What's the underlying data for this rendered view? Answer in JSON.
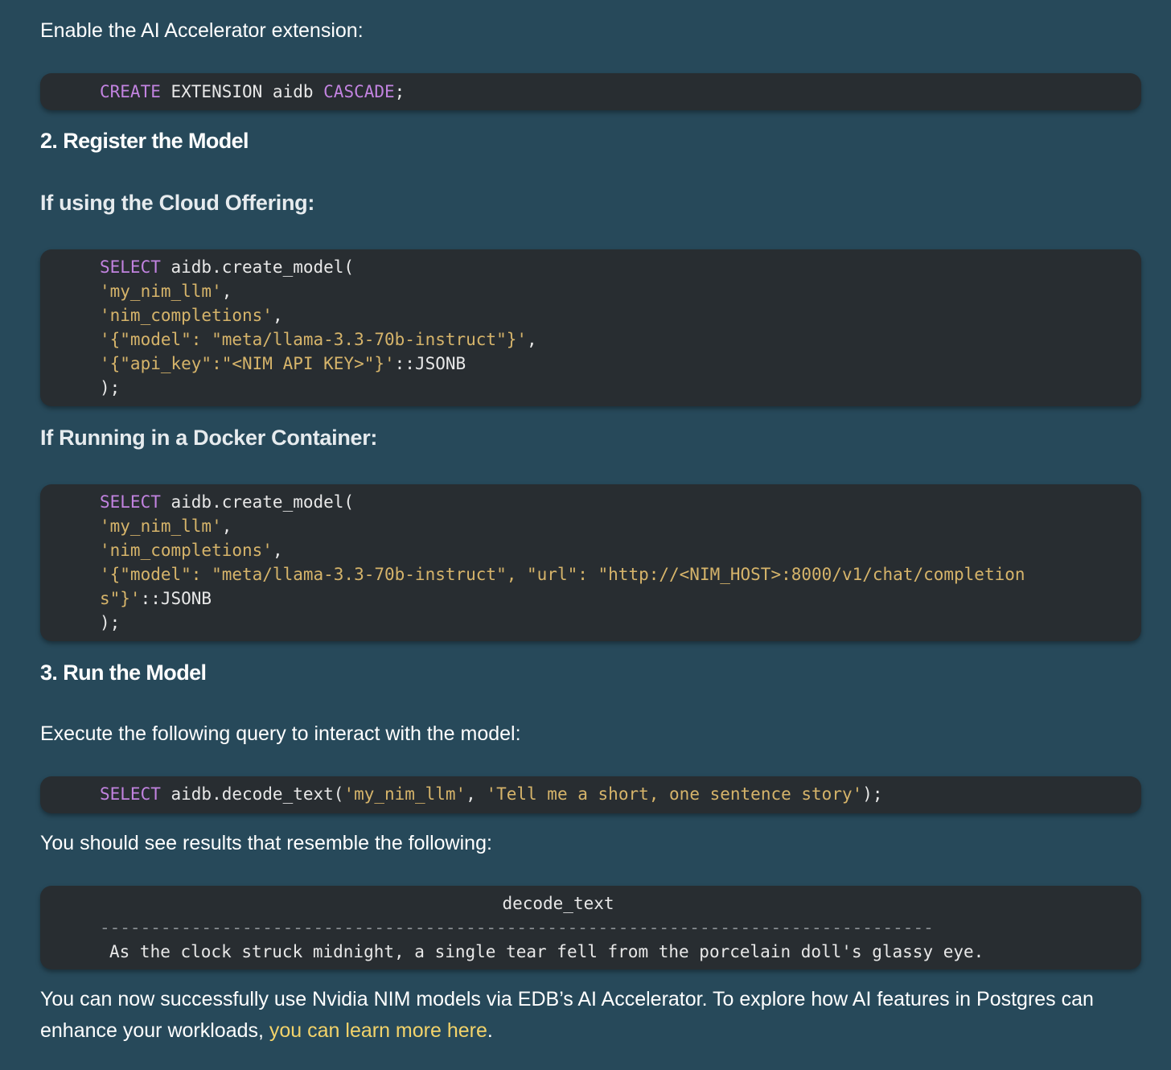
{
  "intro_text": "Enable the AI Accelerator extension:",
  "code1": {
    "lines": [
      [
        {
          "t": "CREATE",
          "c": "kw"
        },
        {
          "t": " EXTENSION aidb ",
          "c": ""
        },
        {
          "t": "CASCADE",
          "c": "kw"
        },
        {
          "t": ";",
          "c": ""
        }
      ]
    ]
  },
  "heading_register": "2. Register the Model",
  "heading_cloud": "If using the Cloud Offering:",
  "code2": {
    "lines": [
      [
        {
          "t": "SELECT",
          "c": "kw"
        },
        {
          "t": " aidb.create_model(",
          "c": ""
        }
      ],
      [
        {
          "t": "'my_nim_llm'",
          "c": "str"
        },
        {
          "t": ",",
          "c": ""
        }
      ],
      [
        {
          "t": "'nim_completions'",
          "c": "str"
        },
        {
          "t": ",",
          "c": ""
        }
      ],
      [
        {
          "t": "'{\"model\": \"meta/llama-3.3-70b-instruct\"}'",
          "c": "str"
        },
        {
          "t": ",",
          "c": ""
        }
      ],
      [
        {
          "t": "'{\"api_key\":\"<NIM API KEY>\"}'",
          "c": "str"
        },
        {
          "t": "::JSONB",
          "c": ""
        }
      ],
      [
        {
          "t": ");",
          "c": ""
        }
      ]
    ]
  },
  "heading_docker": "If Running in a Docker Container:",
  "code3": {
    "lines": [
      [
        {
          "t": "SELECT",
          "c": "kw"
        },
        {
          "t": " aidb.create_model(",
          "c": ""
        }
      ],
      [
        {
          "t": "'my_nim_llm'",
          "c": "str"
        },
        {
          "t": ",",
          "c": ""
        }
      ],
      [
        {
          "t": "'nim_completions'",
          "c": "str"
        },
        {
          "t": ",",
          "c": ""
        }
      ],
      [
        {
          "t": "'{\"model\": \"meta/llama-3.3-70b-instruct\", \"url\": \"http://<NIM_HOST>:8000/v1/chat/completion",
          "c": "str"
        }
      ],
      [
        {
          "t": "s\"}'",
          "c": "str"
        },
        {
          "t": "::JSONB",
          "c": ""
        }
      ],
      [
        {
          "t": ");",
          "c": ""
        }
      ]
    ]
  },
  "heading_run": "3. Run the Model",
  "execute_text": "Execute the following query to interact with the model:",
  "code4": {
    "lines": [
      [
        {
          "t": "SELECT",
          "c": "kw"
        },
        {
          "t": " aidb.decode_text(",
          "c": ""
        },
        {
          "t": "'my_nim_llm'",
          "c": "str"
        },
        {
          "t": ", ",
          "c": ""
        },
        {
          "t": "'Tell me a short, one sentence story'",
          "c": "str"
        },
        {
          "t": ");",
          "c": ""
        }
      ]
    ]
  },
  "results_text": "You should see results that resemble the following:",
  "result": {
    "header": "decode_text",
    "divider": "----------------------------------------------------------------------------------",
    "row": "As the clock struck midnight, a single tear fell from the porcelain doll's glassy eye."
  },
  "closing": {
    "line1": "You can now successfully use Nvidia NIM models via EDB’s AI Accelerator. To explore how AI features in Postgres can",
    "line2_prefix": "enhance your workloads, ",
    "link_text": "you can learn more here",
    "line2_suffix": "."
  },
  "colors": {
    "background": "#27495a",
    "code_background": "#282d31",
    "keyword": "#c283e0",
    "string": "#d6b46a",
    "link": "#f3d36a"
  }
}
